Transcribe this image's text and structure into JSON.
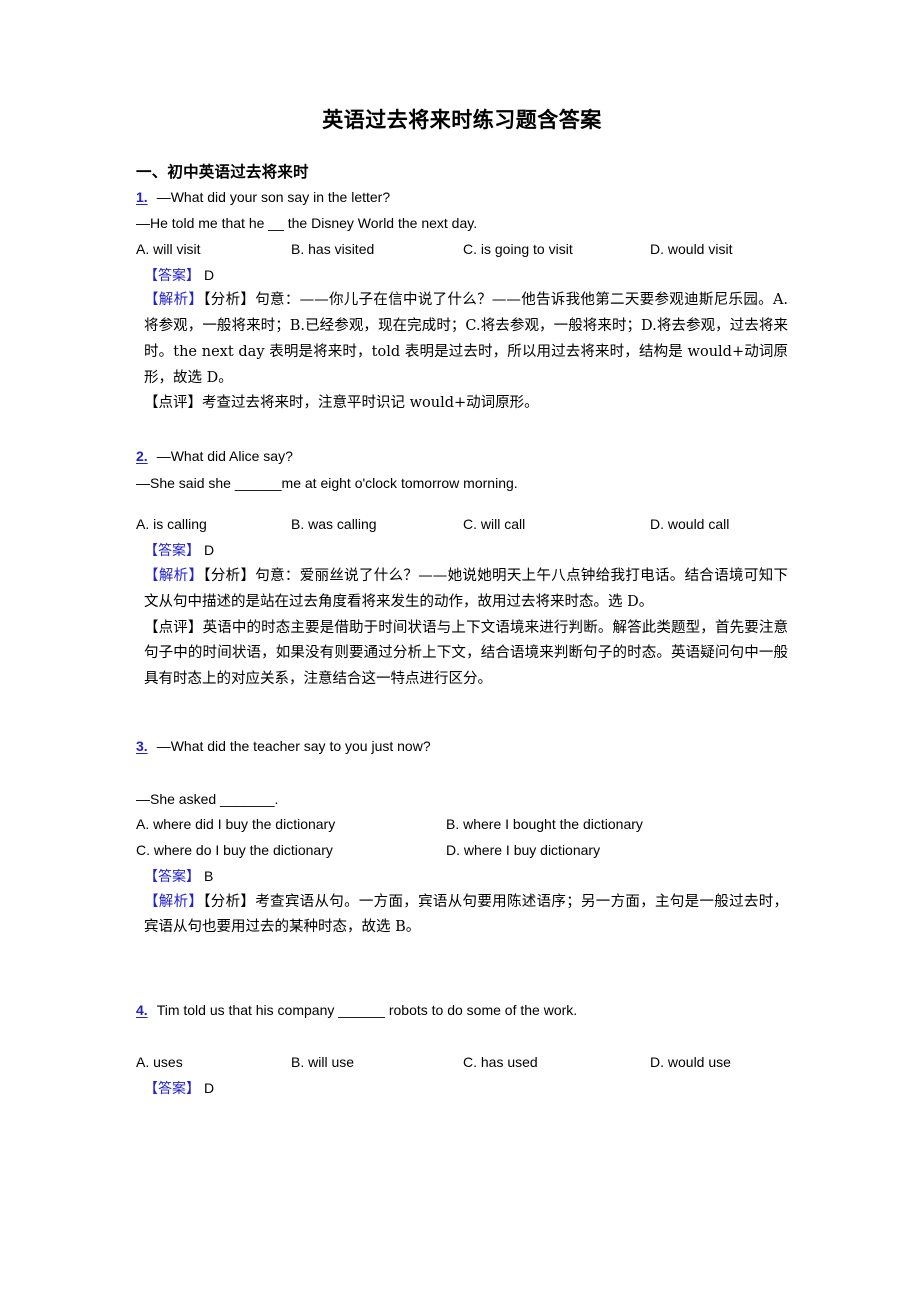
{
  "document": {
    "title": "英语过去将来时练习题含答案",
    "section_heading": "一、初中英语过去将来时"
  },
  "labels": {
    "answer_tag": "【答案】",
    "analysis_tag": "【解析】",
    "analysis_sub_tag": "【分析】",
    "comment_tag": "【点评】"
  },
  "colors": {
    "accent_blue": "#2222cc",
    "text_black": "#000000",
    "page_background": "#ffffff"
  },
  "questions": [
    {
      "number": "1.",
      "prompt_line_1": "—What did your son say in the letter?",
      "prompt_line_2": "—He told me that he __ the Disney World the next day.",
      "options_layout": "four-col",
      "options": [
        "A. will visit",
        "B. has visited",
        "C. is going to visit",
        "D. would visit"
      ],
      "answer": "D",
      "analysis": "句意：——你儿子在信中说了什么？——他告诉我他第二天要参观迪斯尼乐园。A.将参观，一般将来时；B.已经参观，现在完成时；C.将去参观，一般将来时；D.将去参观，过去将来时。the next day 表明是将来时，told 表明是过去时，所以用过去将来时，结构是 would+动词原形，故选 D。",
      "comment": "考查过去将来时，注意平时识记 would+动词原形。"
    },
    {
      "number": "2.",
      "prompt_line_1": "—What did Alice say?",
      "prompt_line_2": "—She said she ______me at eight o'clock tomorrow morning.",
      "options_layout": "four-col",
      "options": [
        "A. is calling",
        "B. was calling",
        "C. will call",
        "D. would call"
      ],
      "answer": "D",
      "analysis": "句意：爱丽丝说了什么？——她说她明天上午八点钟给我打电话。结合语境可知下文从句中描述的是站在过去角度看将来发生的动作，故用过去将来时态。选 D。",
      "comment": "英语中的时态主要是借助于时间状语与上下文语境来进行判断。解答此类题型，首先要注意句子中的时间状语，如果没有则要通过分析上下文，结合语境来判断句子的时态。英语疑问句中一般具有时态上的对应关系，注意结合这一特点进行区分。"
    },
    {
      "number": "3.",
      "prompt_line_1": "—What did the teacher say to you just now?",
      "prompt_line_2": "—She asked _______.",
      "options_layout": "two-col",
      "options": [
        "A. where did I buy the dictionary",
        "B. where I bought the dictionary",
        "C. where do I buy the dictionary",
        "D. where I buy dictionary"
      ],
      "answer": "B",
      "analysis": "考查宾语从句。一方面，宾语从句要用陈述语序；另一方面，主句是一般过去时，宾语从句也要用过去的某种时态，故选 B。",
      "comment": ""
    },
    {
      "number": "4.",
      "prompt_line_1": "Tim told us that his company ______ robots to do some of the work.",
      "prompt_line_2": "",
      "options_layout": "four-col",
      "options": [
        "A. uses",
        "B. will use",
        "C. has used",
        "D. would use"
      ],
      "answer": "D",
      "analysis": "",
      "comment": ""
    }
  ]
}
